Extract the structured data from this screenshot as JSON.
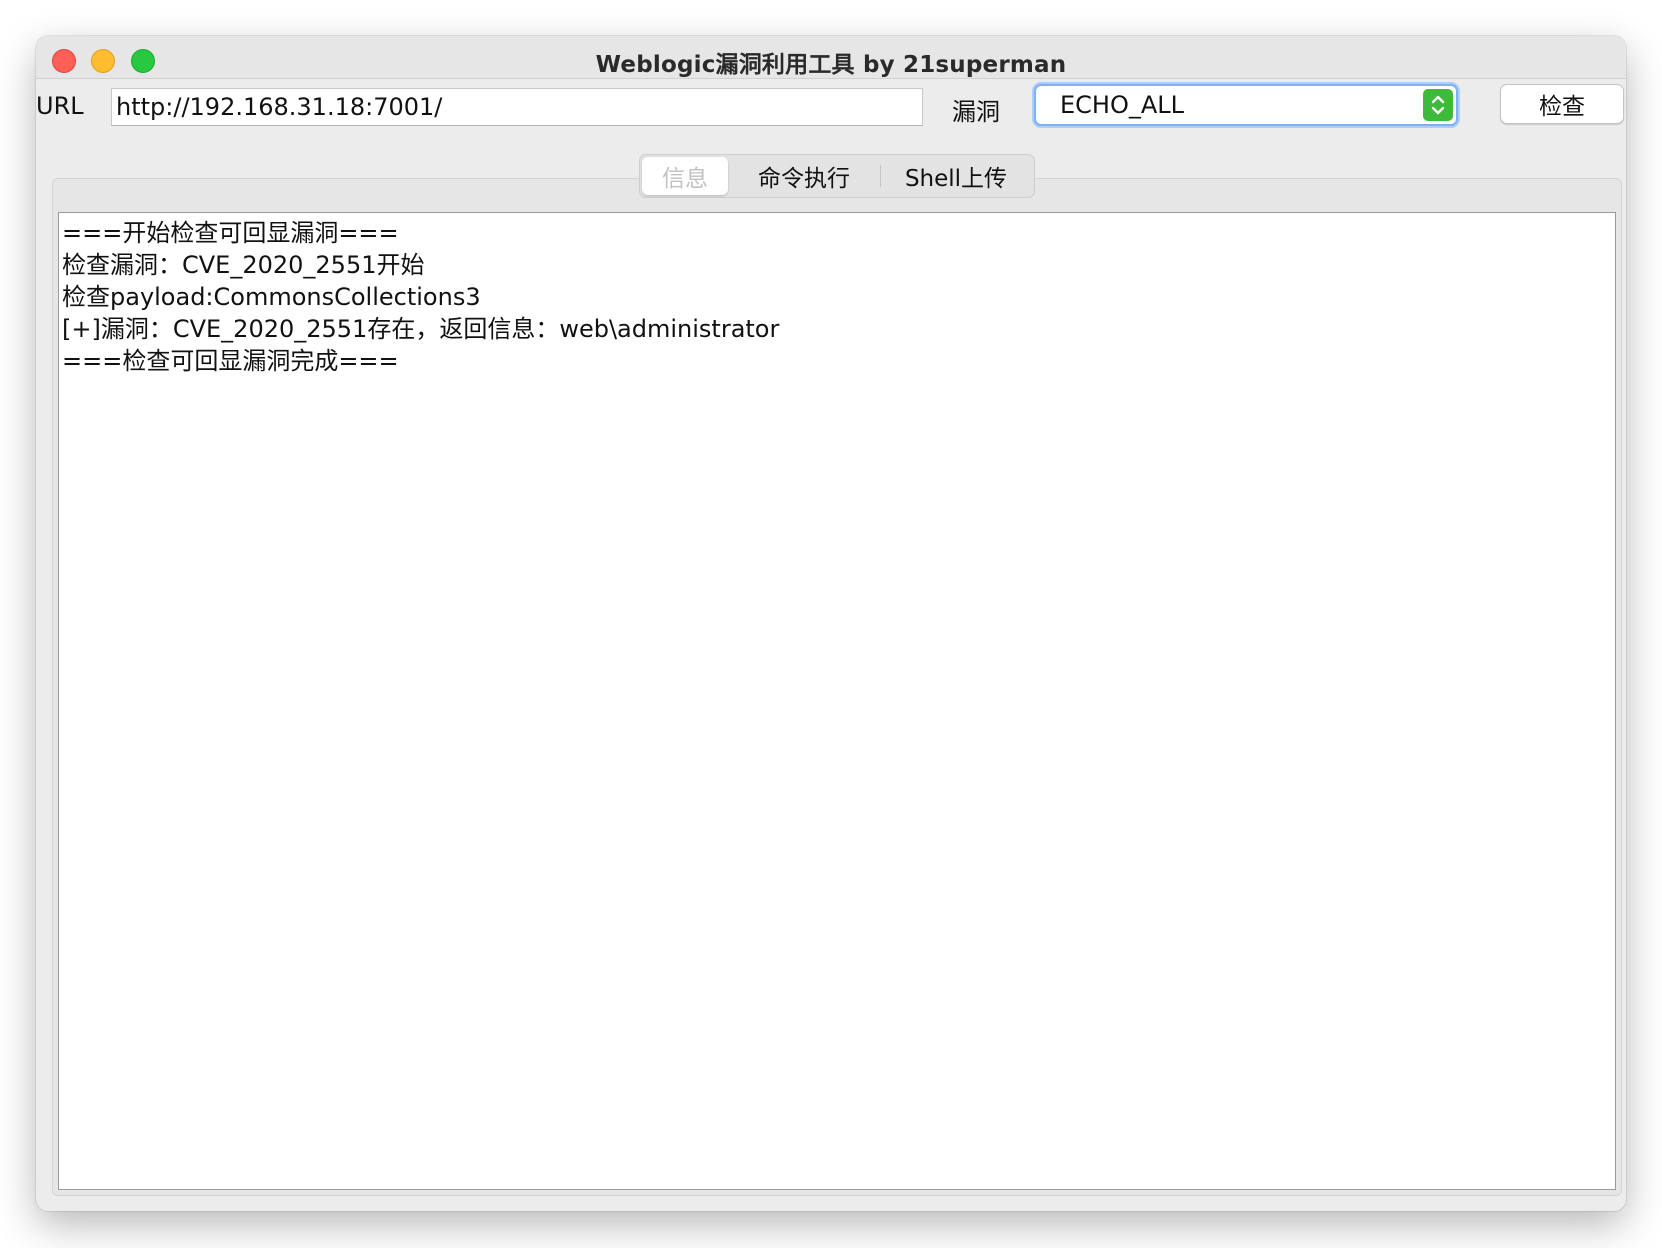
{
  "window": {
    "title": "Weblogic漏洞利用工具 by 21superman"
  },
  "toolbar": {
    "url_label": "URL",
    "url_value": "http://192.168.31.18:7001/",
    "vuln_label": "漏洞",
    "vuln_selected": "ECHO_ALL",
    "check_button": "检查"
  },
  "tabs": [
    {
      "label": "信息",
      "selected": true
    },
    {
      "label": "命令执行",
      "selected": false
    },
    {
      "label": "Shell上传",
      "selected": false
    }
  ],
  "output": {
    "lines": [
      "===开始检查可回显漏洞===",
      "检查漏洞：CVE_2020_2551开始",
      "检查payload:CommonsCollections3",
      "[+]漏洞：CVE_2020_2551存在，返回信息：web\\administrator",
      "===检查可回显漏洞完成==="
    ]
  },
  "colors": {
    "select_focus": "#7fb0f5",
    "select_arrows": "#3dba3a",
    "close": "#fe5f57",
    "minimize": "#febc2e",
    "maximize": "#28c840"
  }
}
